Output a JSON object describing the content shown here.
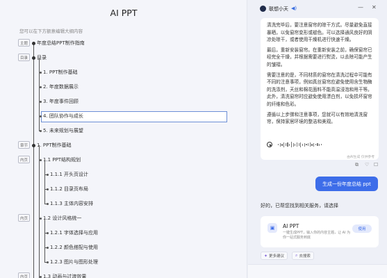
{
  "left": {
    "title": "AI PPT",
    "hint": "您可以在下方额意编辑大纲内容",
    "outline": [
      {
        "tag": "主题",
        "text": "年度总结PPT制作指南",
        "level": 0
      },
      {
        "tag": "目录",
        "text": "目录",
        "level": 0
      },
      {
        "tag": "",
        "text": "1. PPT制作基础",
        "level": 1
      },
      {
        "tag": "",
        "text": "2. 年度数据展示",
        "level": 1
      },
      {
        "tag": "",
        "text": "3. 年度事件回顾",
        "level": 1
      },
      {
        "tag": "",
        "text": "4. 团队协作与成长",
        "level": 1
      },
      {
        "tag": "",
        "text": "5. 未来规划与展望",
        "level": 1
      },
      {
        "tag": "章节",
        "text": "1. PPT制作基础",
        "level": 0
      },
      {
        "tag": "内页",
        "text": "1.1 PPT结构规划",
        "level": 1
      },
      {
        "tag": "",
        "text": "1.1.1 开头页设计",
        "level": 2
      },
      {
        "tag": "",
        "text": "1.1.2 目录页布局",
        "level": 2
      },
      {
        "tag": "",
        "text": "1.1.3 主体内容安排",
        "level": 2
      },
      {
        "tag": "内页",
        "text": "1.2 设计风格统一",
        "level": 1
      },
      {
        "tag": "",
        "text": "1.2.1 字体选择与应用",
        "level": 2
      },
      {
        "tag": "",
        "text": "1.2.2 颜色搭配与使用",
        "level": 2
      },
      {
        "tag": "",
        "text": "1.2.3 图片与图形处理",
        "level": 2
      },
      {
        "tag": "内页",
        "text": "1.3 动画与过渡效果",
        "level": 1
      }
    ]
  },
  "right": {
    "assistant_name": "联想小天",
    "window": {
      "min": "—",
      "max": "▭",
      "close": "✕"
    },
    "message_paragraphs": [
      "清洗完毕后，要注意窗帘的晾干方式。尽量避免直接暴晒，以免窗帘变形或褪色。可以选择通风良好的阴凉处晾干，或者使用干燥机进行快速干燥。",
      "最后，重新安装窗帘。在重新安装之前，确保窗帘已经完全干燥，并根据需要进行熨烫，以去除可能产生的皱褶。",
      "需要注意的是，不同材质的窗帘在清洗过程中可能有不同的注意事项，例如真丝窗帘应避免使用含生物酶的洗涤剂，天丝和棉花面料不能高温浸泡和甩干等。此外，清洗窗帘时应避免使用漂白剂，以免损坏窗帘的纤维和色彩。",
      "遵循以上步骤和注意事项，您就可以有效地清洗窗帘，保持家居环境的整洁和美观。"
    ],
    "ai_note": "由AI生成 仅供参考",
    "user_message": "生成一份年度总结 ppt",
    "reply": "好的，已帮您找到相关服务，请选择",
    "tool": {
      "name": "AI PPT",
      "desc": "一键生成PPT，输入你的内容主题，让 AI 为你一站式服务到底",
      "button": "使用"
    },
    "chips": [
      "更多建议",
      "去搜索"
    ]
  },
  "colors": {
    "accent": "#3d6de9",
    "selected_border": "#6d8fd6"
  }
}
